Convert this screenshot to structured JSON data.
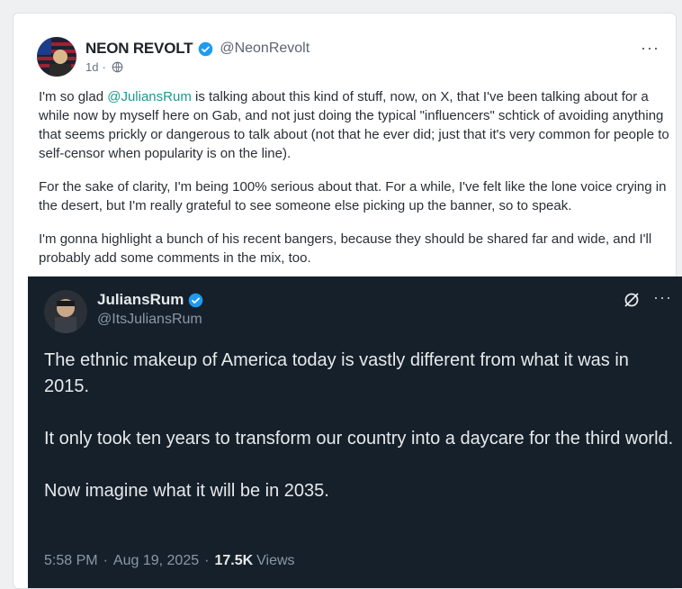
{
  "post": {
    "display_name": "NEON REVOLT",
    "handle": "@NeonRevolt",
    "time": "1d",
    "separator": "·",
    "more_label": "···",
    "paragraphs": [
      {
        "before": "I'm so glad ",
        "mention": "@JuliansRum",
        "after": " is talking about this kind of stuff, now, on X, that I've been talking about for a while now by myself here on Gab, and not just doing the typical \"influencers\" schtick of avoiding anything that seems prickly or dangerous to talk about (not that he ever did; just that it's very common for people to self-censor when popularity is on the line)."
      },
      {
        "text": "For the sake of clarity, I'm being 100% serious about that. For a while, I've felt like the lone voice crying in the desert, but I'm really grateful to see someone else picking up the banner, so to speak."
      },
      {
        "text": "I'm gonna highlight a bunch of his recent bangers, because they should be shared far and wide, and I'll probably add some comments in the mix, too."
      }
    ]
  },
  "embed": {
    "display_name": "JuliansRum",
    "handle": "@ItsJuliansRum",
    "more_label": "···",
    "paragraphs": [
      "The ethnic makeup of America today is vastly different from what it was in 2015.",
      "It only took ten years to transform our country into a daycare for the third world.",
      "Now imagine what it will be in 2035."
    ],
    "time": "5:58 PM",
    "date": "Aug 19, 2025",
    "separator": "·",
    "views_count": "17.5K",
    "views_label": "Views"
  },
  "colors": {
    "mention": "#1a9a8f",
    "verified": "#1d9bf0",
    "embed_bg": "#15202b"
  },
  "icons": [
    "verified-badge-icon",
    "globe-icon",
    "more-options-icon",
    "grok-icon"
  ]
}
